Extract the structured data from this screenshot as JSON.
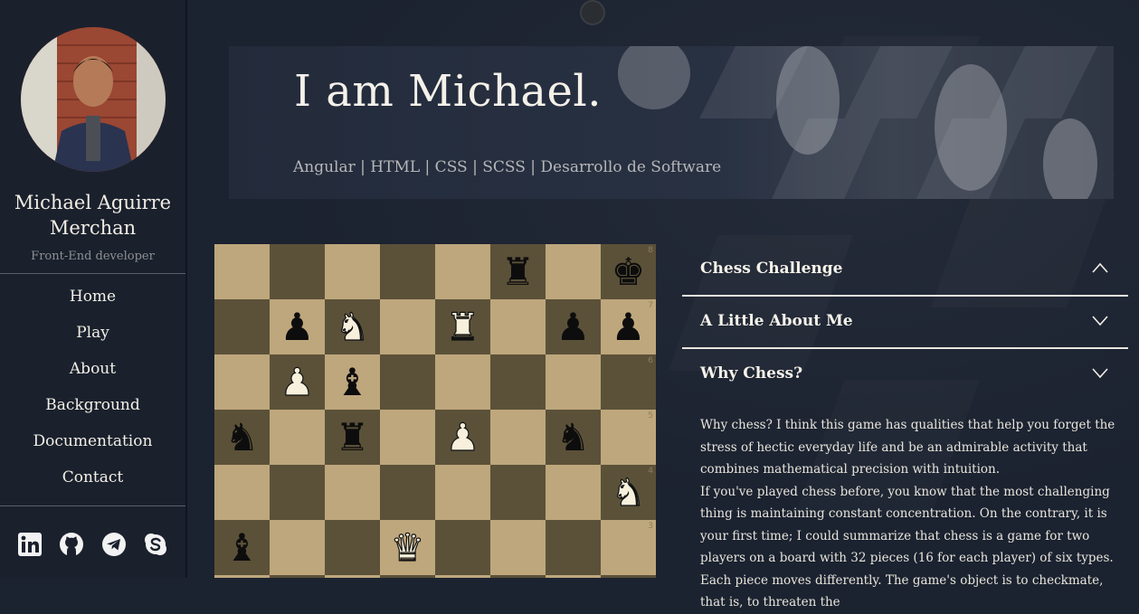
{
  "sidebar": {
    "name": "Michael Aguirre Merchan",
    "role": "Front-End developer",
    "nav": [
      "Home",
      "Play",
      "About",
      "Background",
      "Documentation",
      "Contact"
    ],
    "socials": [
      "linkedin-icon",
      "github-icon",
      "telegram-icon",
      "skype-icon"
    ]
  },
  "banner": {
    "title": "I am Michael.",
    "skills": "Angular | HTML | CSS | SCSS | Desarrollo de Software"
  },
  "board": {
    "ranks": [
      "8",
      "7",
      "6",
      "5",
      "4",
      "3"
    ],
    "pieces": [
      {
        "square": "f8",
        "glyph": "♜",
        "color": "black"
      },
      {
        "square": "h8",
        "glyph": "♚",
        "color": "black"
      },
      {
        "square": "b7",
        "glyph": "♟",
        "color": "black"
      },
      {
        "square": "c7",
        "glyph": "♞",
        "color": "white"
      },
      {
        "square": "e7",
        "glyph": "♜",
        "color": "white"
      },
      {
        "square": "g7",
        "glyph": "♟",
        "color": "black"
      },
      {
        "square": "h7",
        "glyph": "♟",
        "color": "black"
      },
      {
        "square": "b6",
        "glyph": "♟",
        "color": "white"
      },
      {
        "square": "c6",
        "glyph": "♝",
        "color": "black"
      },
      {
        "square": "a5",
        "glyph": "♞",
        "color": "black"
      },
      {
        "square": "c5",
        "glyph": "♜",
        "color": "black"
      },
      {
        "square": "e5",
        "glyph": "♟",
        "color": "white"
      },
      {
        "square": "g5",
        "glyph": "♞",
        "color": "black"
      },
      {
        "square": "h4",
        "glyph": "♞",
        "color": "white"
      },
      {
        "square": "a3",
        "glyph": "♝",
        "color": "black"
      },
      {
        "square": "d3",
        "glyph": "♛",
        "color": "white"
      }
    ]
  },
  "accordion": {
    "items": [
      {
        "title": "Chess Challenge",
        "state": "open"
      },
      {
        "title": "A Little About Me",
        "state": "closed"
      },
      {
        "title": "Why Chess?",
        "state": "closed"
      }
    ],
    "body": [
      "Why chess? I think this game has qualities that help you forget the stress of hectic everyday life and be an admirable activity that combines mathematical precision with intuition.",
      "If you've played chess before, you know that the most challenging thing is maintaining constant concentration. On the contrary, it is your first time; I could summarize that chess is a game for two players on a board with 32 pieces (16 for each player) of six types. Each piece moves differently. The game's object is to checkmate, that is, to threaten the"
    ]
  },
  "colors": {
    "background": "#1c2330",
    "light_square": "#bea77c",
    "dark_square": "#5b5139"
  }
}
